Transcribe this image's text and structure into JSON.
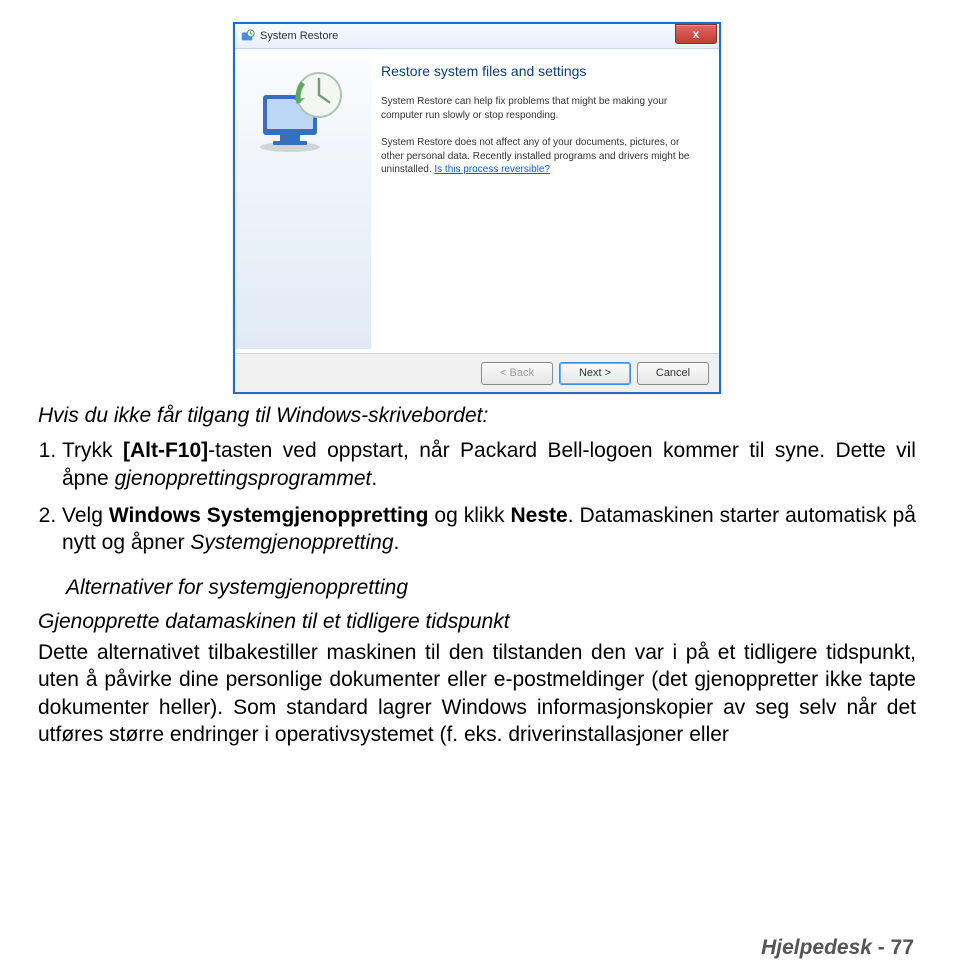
{
  "window": {
    "title": "System Restore",
    "close_glyph": "x",
    "heading": "Restore system files and settings",
    "para1": "System Restore can help fix problems that might be making your computer run slowly or stop responding.",
    "para2a": "System Restore does not affect any of your documents, pictures, or other personal data. Recently installed programs and drivers might be uninstalled. ",
    "link": "Is this process reversible?",
    "btn_back": "< Back",
    "btn_next": "Next >",
    "btn_cancel": "Cancel"
  },
  "doc": {
    "intro": "Hvis du ikke får tilgang til Windows-skrivebordet:",
    "li1_a": "Trykk ",
    "li1_bold": "[Alt-F10]",
    "li1_b": "-tasten ved oppstart, når Packard Bell-logoen kommer til syne. Dette vil åpne ",
    "li1_ital": "gjenopprettingsprogrammet",
    "li1_c": ".",
    "li2_a": "Velg ",
    "li2_bold1": "Windows Systemgjenoppretting",
    "li2_b": " og klikk ",
    "li2_bold2": "Neste",
    "li2_c": ". Datamaskinen starter automatisk på nytt og åpner ",
    "li2_ital": "Systemgjenoppretting",
    "li2_d": ".",
    "sub": "Alternativer for systemgjenoppretting",
    "sub2": "Gjenopprette datamaskinen til et tidligere tidspunkt",
    "body": "Dette alternativet tilbakestiller maskinen til den tilstanden den var i på et tidligere tidspunkt, uten å påvirke dine personlige dokumenter eller e-postmeldinger (det gjenoppretter ikke tapte dokumenter heller). Som standard lagrer Windows informasjonskopier av seg selv når det utføres større endringer i operativsystemet (f. eks. driverinstallasjoner eller"
  },
  "footer": {
    "label": "Hjelpedesk -",
    "page": "77"
  }
}
